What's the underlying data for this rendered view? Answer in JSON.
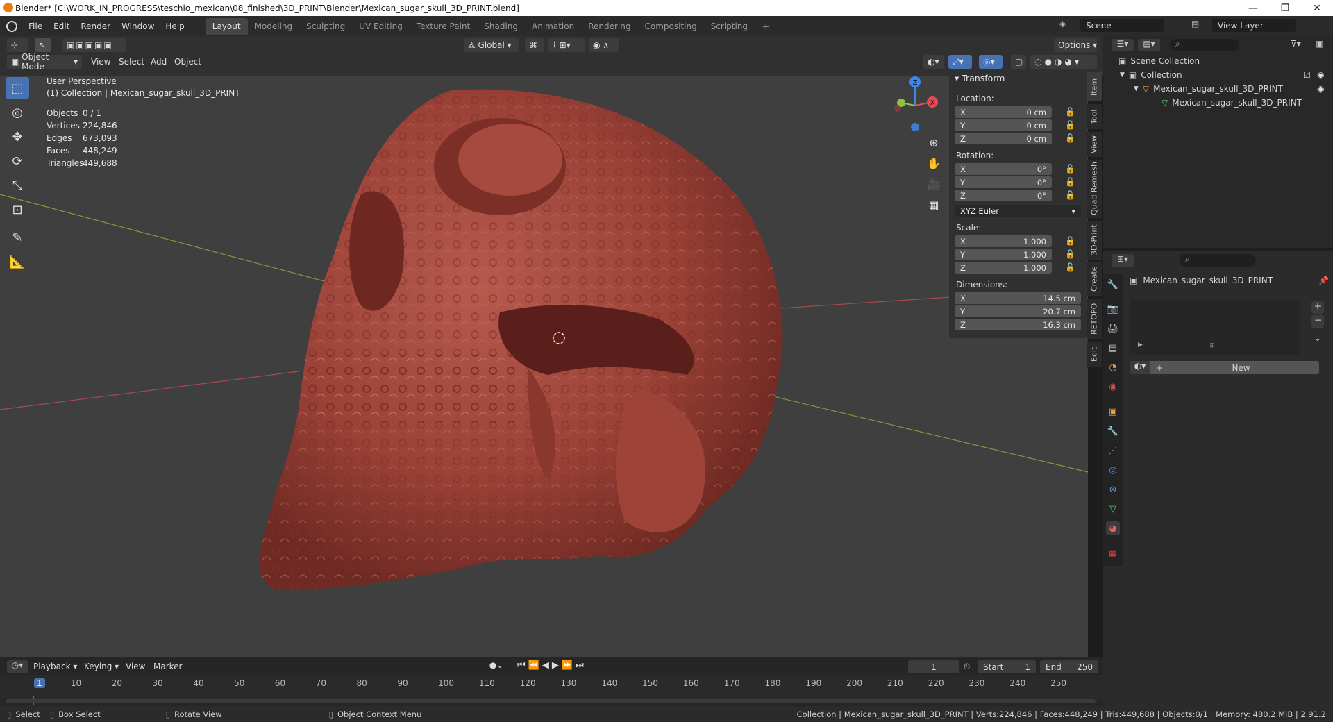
{
  "window": {
    "title": "Blender* [C:\\WORK_IN_PROGRESS\\teschio_mexican\\08_finished\\3D_PRINT\\Blender\\Mexican_sugar_skull_3D_PRINT.blend]",
    "minimize": "—",
    "maximize": "❐",
    "close": "✕"
  },
  "menu": [
    "File",
    "Edit",
    "Render",
    "Window",
    "Help"
  ],
  "workspaces": [
    "Layout",
    "Modeling",
    "Sculpting",
    "UV Editing",
    "Texture Paint",
    "Shading",
    "Animation",
    "Rendering",
    "Compositing",
    "Scripting"
  ],
  "workspace_add": "+",
  "scene": {
    "name": "Scene",
    "view_layer": "View Layer"
  },
  "header": {
    "orientation": "Global",
    "options": "Options",
    "mode": "Object Mode",
    "menus": [
      "View",
      "Select",
      "Add",
      "Object"
    ]
  },
  "viewport": {
    "perspective": "User Perspective",
    "collection_info": "(1) Collection | Mexican_sugar_skull_3D_PRINT",
    "stats": [
      [
        "Objects",
        "0 / 1"
      ],
      [
        "Vertices",
        "224,846"
      ],
      [
        "Edges",
        "673,093"
      ],
      [
        "Faces",
        "448,249"
      ],
      [
        "Triangles",
        "449,688"
      ]
    ],
    "axes": {
      "x": "X",
      "y": "Y",
      "z": "Z"
    }
  },
  "npanel": {
    "title": "Transform",
    "location_label": "Location:",
    "rotation_label": "Rotation:",
    "scale_label": "Scale:",
    "dimensions_label": "Dimensions:",
    "location": [
      [
        "X",
        "0 cm"
      ],
      [
        "Y",
        "0 cm"
      ],
      [
        "Z",
        "0 cm"
      ]
    ],
    "rotation": [
      [
        "X",
        "0°"
      ],
      [
        "Y",
        "0°"
      ],
      [
        "Z",
        "0°"
      ]
    ],
    "rotation_mode": "XYZ Euler",
    "scale": [
      [
        "X",
        "1.000"
      ],
      [
        "Y",
        "1.000"
      ],
      [
        "Z",
        "1.000"
      ]
    ],
    "dimensions": [
      [
        "X",
        "14.5 cm"
      ],
      [
        "Y",
        "20.7 cm"
      ],
      [
        "Z",
        "16.3 cm"
      ]
    ]
  },
  "side_tabs": [
    "Item",
    "Tool",
    "View",
    "Quad Remesh",
    "3D-Print",
    "Create",
    "RETOPO",
    "Edit"
  ],
  "outliner": {
    "root": "Scene Collection",
    "collection": "Collection",
    "object": "Mexican_sugar_skull_3D_PRINT",
    "mesh": "Mexican_sugar_skull_3D_PRINT"
  },
  "properties": {
    "object_name": "Mexican_sugar_skull_3D_PRINT",
    "new_button": "New",
    "plus": "+",
    "minus": "−"
  },
  "timeline": {
    "menus": [
      "Playback",
      "Keying",
      "View",
      "Marker"
    ],
    "current_frame": "1",
    "start_label": "Start",
    "start": "1",
    "end_label": "End",
    "end": "250",
    "ticks": [
      "1",
      "10",
      "20",
      "30",
      "40",
      "50",
      "60",
      "70",
      "80",
      "90",
      "100",
      "110",
      "120",
      "130",
      "140",
      "150",
      "160",
      "170",
      "180",
      "190",
      "200",
      "210",
      "220",
      "230",
      "240",
      "250"
    ]
  },
  "statusbar": {
    "select": "Select",
    "box_select": "Box Select",
    "rotate_view": "Rotate View",
    "context_menu": "Object Context Menu",
    "info": "Collection | Mexican_sugar_skull_3D_PRINT | Verts:224,846 | Faces:448,249 | Tris:449,688 | Objects:0/1 | Memory: 480.2 MiB | 2.91.2"
  },
  "colors": {
    "accent": "#4772b3",
    "model": "#a0453c",
    "x_axis": "#e84a55",
    "y_axis": "#8ac43c",
    "z_axis": "#3b88e8"
  }
}
